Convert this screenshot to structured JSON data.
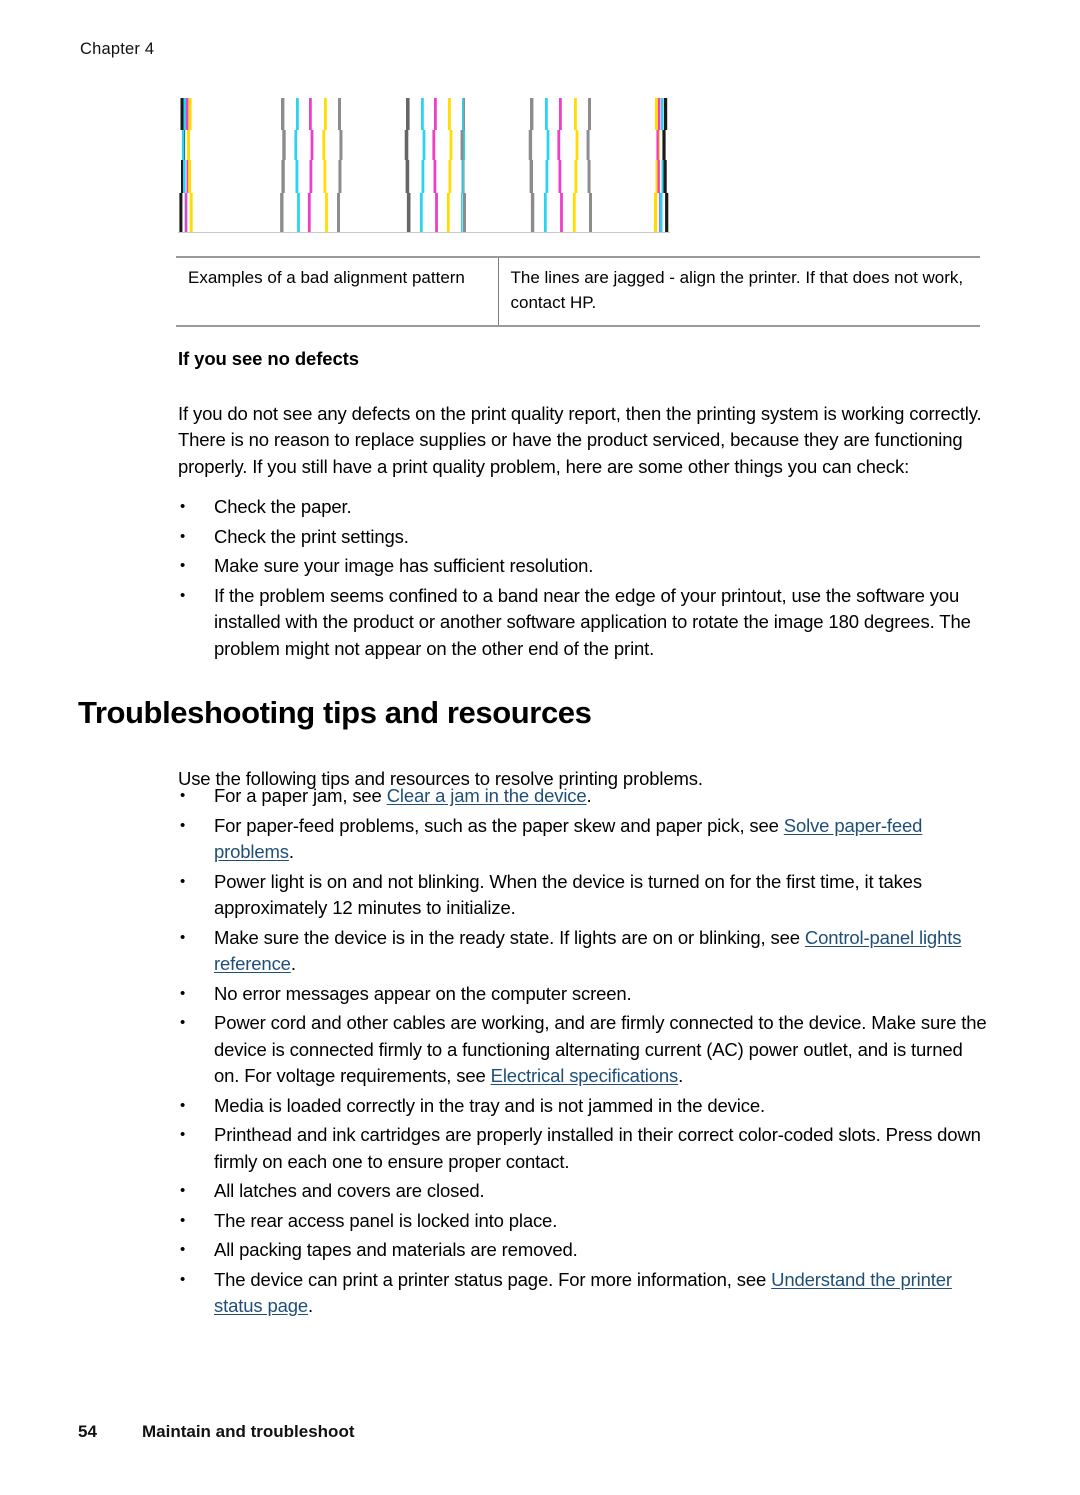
{
  "header": {
    "chapter": "Chapter 4"
  },
  "figure": {
    "name": "bad-alignment-pattern",
    "colors": {
      "black": "#1a1a1a",
      "cyan": "#2ad4ee",
      "magenta": "#ef3fc8",
      "yellow": "#ffdd00",
      "gray": "#8c8c8c",
      "dark_gray": "#666666",
      "baseline": "#c9c9c9"
    }
  },
  "caption_table": {
    "left_cell": "Examples of a bad alignment pattern",
    "right_cell": "The lines are jagged - align the printer. If that does not work, contact HP."
  },
  "no_defects": {
    "heading": "If you see no defects",
    "paragraph": "If you do not see any defects on the print quality report, then the printing system is working correctly. There is no reason to replace supplies or have the product serviced, because they are functioning properly. If you still have a print quality problem, here are some other things you can check:",
    "bullets": [
      "Check the paper.",
      "Check the print settings.",
      "Make sure your image has sufficient resolution.",
      "If the problem seems confined to a band near the edge of your printout, use the software you installed with the product or another software application to rotate the image 180 degrees. The problem might not appear on the other end of the print."
    ]
  },
  "troubleshooting": {
    "heading": "Troubleshooting tips and resources",
    "intro": "Use the following tips and resources to resolve printing problems.",
    "bullets": [
      {
        "before": "For a paper jam, see ",
        "link": "Clear a jam in the device",
        "after": "."
      },
      {
        "before": "For paper-feed problems, such as the paper skew and paper pick, see ",
        "link": "Solve paper-feed problems",
        "after": "."
      },
      {
        "before": "Power light is on and not blinking. When the device is turned on for the first time, it takes approximately 12 minutes to initialize.",
        "link": "",
        "after": ""
      },
      {
        "before": "Make sure the device is in the ready state. If lights are on or blinking, see ",
        "link": "Control-panel lights reference",
        "after": "."
      },
      {
        "before": "No error messages appear on the computer screen.",
        "link": "",
        "after": ""
      },
      {
        "before": "Power cord and other cables are working, and are firmly connected to the device. Make sure the device is connected firmly to a functioning alternating current (AC) power outlet, and is turned on. For voltage requirements, see ",
        "link": "Electrical specifications",
        "after": "."
      },
      {
        "before": "Media is loaded correctly in the tray and is not jammed in the device.",
        "link": "",
        "after": ""
      },
      {
        "before": "Printhead and ink cartridges are properly installed in their correct color-coded slots. Press down firmly on each one to ensure proper contact.",
        "link": "",
        "after": ""
      },
      {
        "before": "All latches and covers are closed.",
        "link": "",
        "after": ""
      },
      {
        "before": "The rear access panel is locked into place.",
        "link": "",
        "after": ""
      },
      {
        "before": "All packing tapes and materials are removed.",
        "link": "",
        "after": ""
      },
      {
        "before": "The device can print a printer status page. For more information, see ",
        "link": "Understand the printer status page",
        "after": "."
      }
    ]
  },
  "footer": {
    "page_number": "54",
    "section_title": "Maintain and troubleshoot"
  },
  "link_color": "#1f4e79"
}
